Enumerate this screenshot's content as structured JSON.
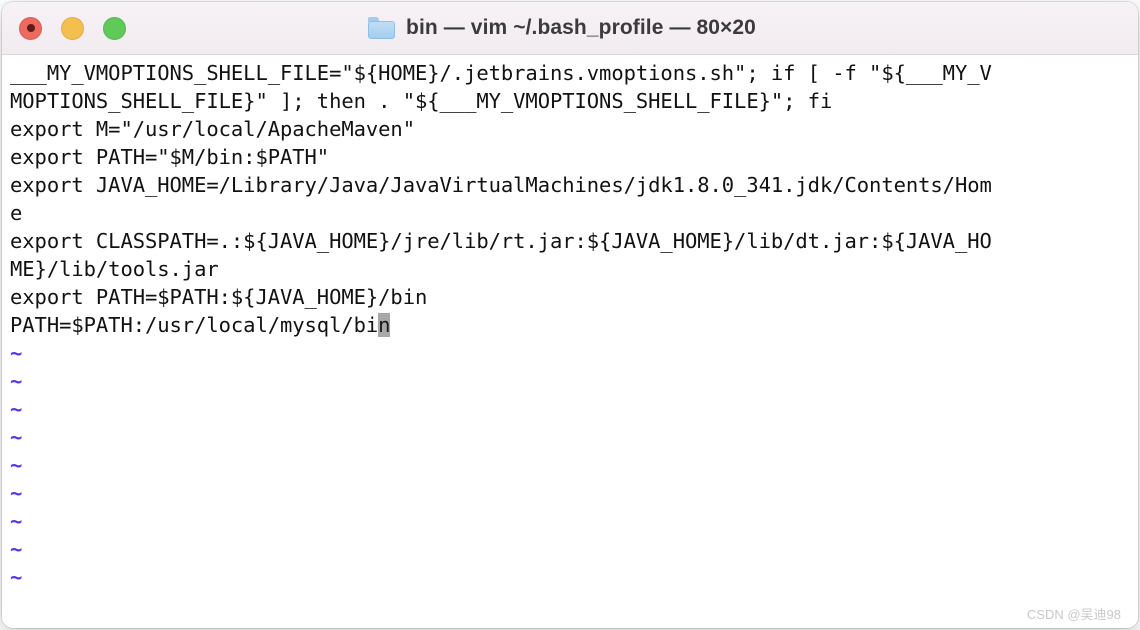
{
  "window": {
    "title": "bin — vim ~/.bash_profile — 80×20",
    "folder_icon": "folder-icon",
    "controls": [
      {
        "name": "close",
        "label": "Close",
        "color": "#ec6a5f"
      },
      {
        "name": "minimize",
        "label": "Minimize",
        "color": "#f3bf4f"
      },
      {
        "name": "maximize",
        "label": "Maximize",
        "color": "#5fc95a"
      }
    ]
  },
  "terminal": {
    "cols": 80,
    "rows": 20,
    "background": "#ffffff",
    "foreground": "#121212",
    "tilde_color": "#4a3ce8",
    "cursor_color": "#a8a8a8",
    "lines": [
      {
        "text": "___MY_VMOPTIONS_SHELL_FILE=\"${HOME}/.jetbrains.vmoptions.sh\"; if [ -f \"${___MY_V",
        "type": "text"
      },
      {
        "text": "MOPTIONS_SHELL_FILE}\" ]; then . \"${___MY_VMOPTIONS_SHELL_FILE}\"; fi",
        "type": "text"
      },
      {
        "text": "export M=\"/usr/local/ApacheMaven\"",
        "type": "text"
      },
      {
        "text": "export PATH=\"$M/bin:$PATH\"",
        "type": "text"
      },
      {
        "text": "export JAVA_HOME=/Library/Java/JavaVirtualMachines/jdk1.8.0_341.jdk/Contents/Hom",
        "type": "text"
      },
      {
        "text": "e",
        "type": "text"
      },
      {
        "text": "export CLASSPATH=.:${JAVA_HOME}/jre/lib/rt.jar:${JAVA_HOME}/lib/dt.jar:${JAVA_HO",
        "type": "text"
      },
      {
        "text": "ME}/lib/tools.jar",
        "type": "text"
      },
      {
        "text": "export PATH=$PATH:${JAVA_HOME}/bin",
        "type": "text"
      },
      {
        "text": "PATH=$PATH:/usr/local/mysql/bi",
        "type": "cursor-line",
        "cursor_char": "n"
      },
      {
        "text": "~",
        "type": "tilde"
      },
      {
        "text": "~",
        "type": "tilde"
      },
      {
        "text": "~",
        "type": "tilde"
      },
      {
        "text": "~",
        "type": "tilde"
      },
      {
        "text": "~",
        "type": "tilde"
      },
      {
        "text": "~",
        "type": "tilde"
      },
      {
        "text": "~",
        "type": "tilde"
      },
      {
        "text": "~",
        "type": "tilde"
      },
      {
        "text": "~",
        "type": "tilde"
      }
    ]
  },
  "watermark": {
    "text": "CSDN @吴迪98"
  }
}
